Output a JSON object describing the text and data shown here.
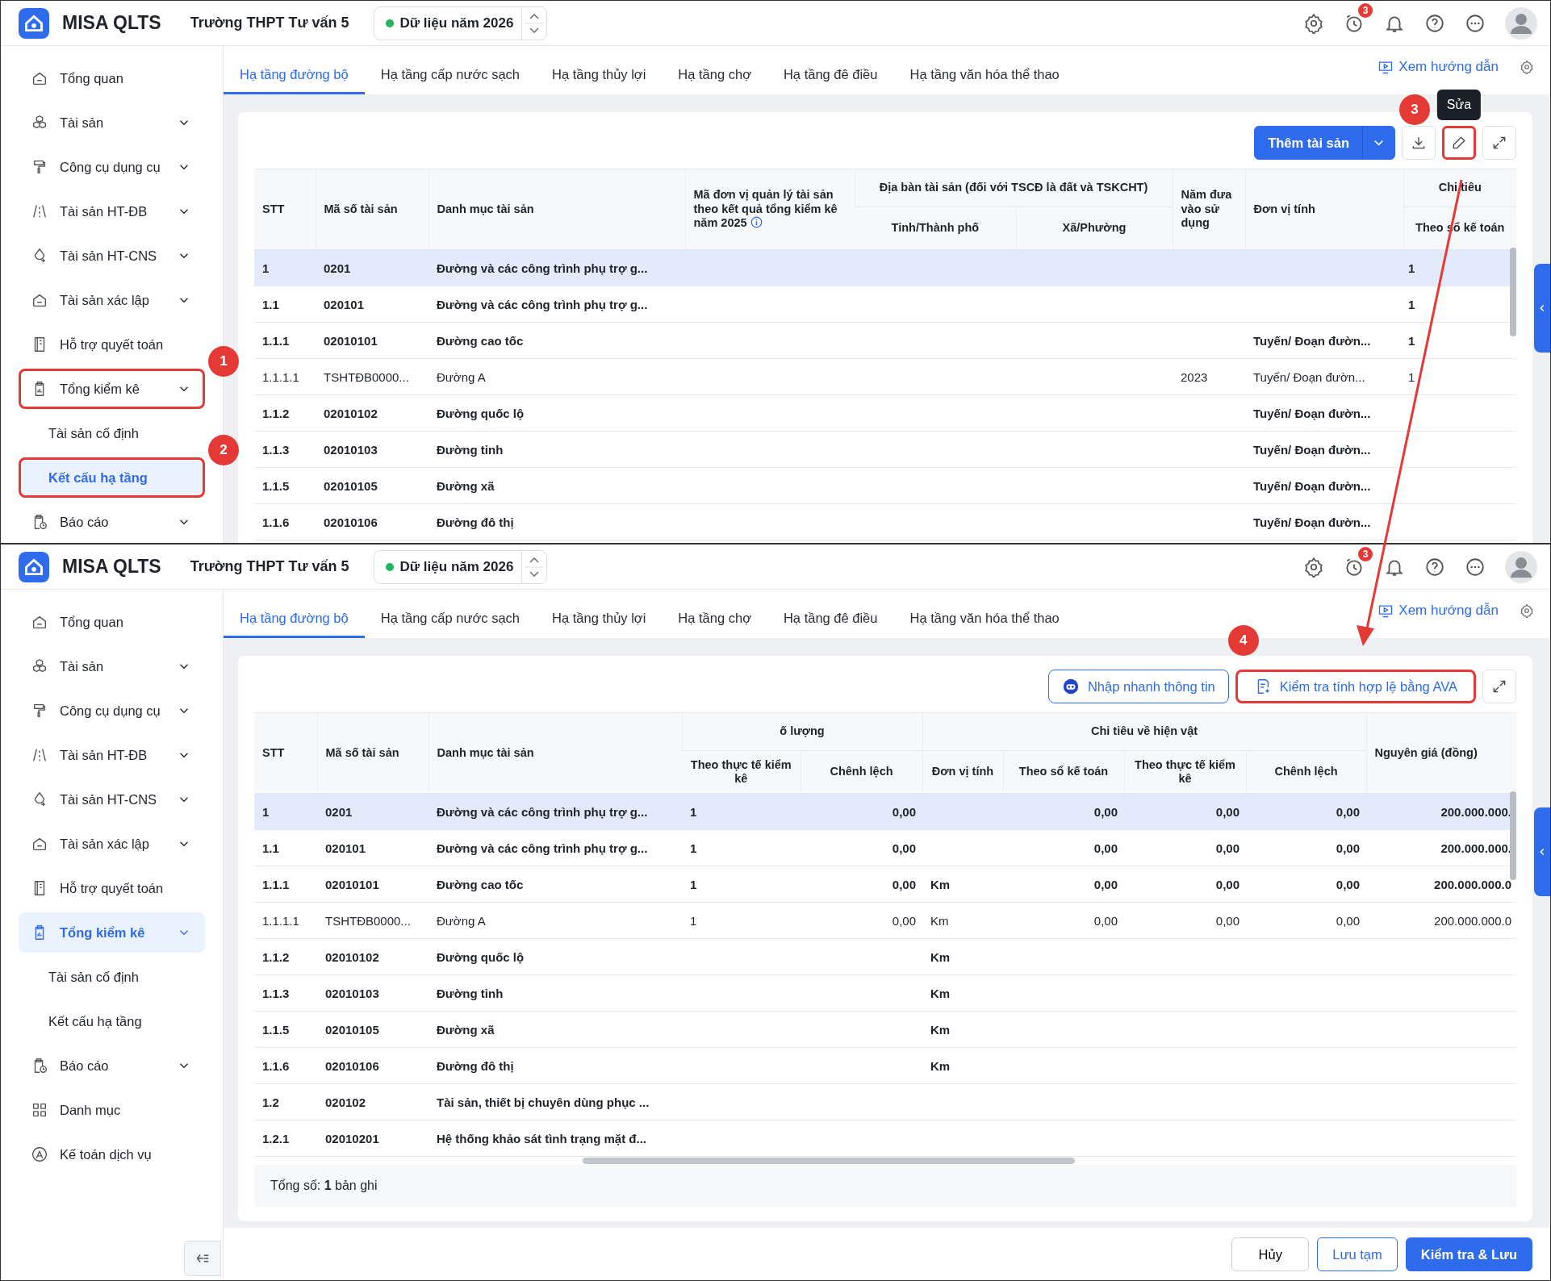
{
  "screens": [
    {
      "header": {
        "app_name": "MISA QLTS",
        "unit": "Trường THPT Tư vấn 5",
        "data_year": "Dữ liệu năm 2026",
        "badge": "3"
      },
      "sidebar": [
        {
          "label": "Tổng quan",
          "kind": "link",
          "selected": false
        },
        {
          "label": "Tài sản",
          "kind": "menu",
          "selected": false
        },
        {
          "label": "Công cụ dụng cụ",
          "kind": "menu",
          "selected": false
        },
        {
          "label": "Tài sản HT-ĐB",
          "kind": "menu",
          "selected": false
        },
        {
          "label": "Tài sản HT-CNS",
          "kind": "menu",
          "selected": false
        },
        {
          "label": "Tài sản xác lập",
          "kind": "menu",
          "selected": false
        },
        {
          "label": "Hỗ trợ quyết toán",
          "kind": "link",
          "selected": false
        },
        {
          "label": "Tổng kiểm kê",
          "kind": "menu",
          "selected": false,
          "marker": "1",
          "children": [
            {
              "label": "Tài sản cố định",
              "selected": false
            },
            {
              "label": "Kết cấu hạ tầng",
              "selected": true,
              "marker": "2"
            }
          ]
        },
        {
          "label": "Báo cáo",
          "kind": "menu",
          "selected": false
        }
      ],
      "guide_link": "Xem hướng dẫn",
      "tabs": [
        {
          "label": "Hạ tầng đường bộ",
          "selected": true
        },
        {
          "label": "Hạ tầng cấp nước sạch",
          "selected": false
        },
        {
          "label": "Hạ tầng thủy lợi",
          "selected": false
        },
        {
          "label": "Hạ tầng chợ",
          "selected": false
        },
        {
          "label": "Hạ tầng đê điều",
          "selected": false
        },
        {
          "label": "Hạ tầng văn hóa thể thao",
          "selected": false
        }
      ],
      "toolbar": [
        {
          "kind": "split",
          "label": "Thêm tài sản"
        },
        {
          "kind": "download"
        },
        {
          "kind": "edit",
          "marker": "3",
          "tooltip": "Sửa"
        },
        {
          "kind": "expand"
        }
      ],
      "table": {
        "columns": [
          {
            "label": "STT"
          },
          {
            "label": "Mã số tài sản"
          },
          {
            "label": "Danh mục tài sản"
          },
          {
            "label": "Mã đơn vị quản lý tài sản theo kết quả tổng kiểm kê năm 2025",
            "info": true
          },
          {
            "label": "Địa bàn tài sản (đối với TSCĐ là đất và TSKCHT)",
            "colspan": 2,
            "children": [
              {
                "label": "Tỉnh/Thành phố"
              },
              {
                "label": "Xã/Phường"
              }
            ]
          },
          {
            "label": "Năm đưa vào sử dụng"
          },
          {
            "label": "Đơn vị tính"
          },
          {
            "label": "Chi tiêu",
            "children": [
              {
                "label": "Theo sổ kế toán"
              }
            ]
          }
        ],
        "rows": [
          {
            "kind": "group",
            "selected": true,
            "cells": [
              "1",
              "0201",
              "Đường và các công trình phụ trợ g...",
              null,
              null,
              null,
              null,
              null,
              "1"
            ]
          },
          {
            "kind": "group",
            "selected": false,
            "cells": [
              "1.1",
              "020101",
              "Đường và các công trình phụ trợ g...",
              null,
              null,
              null,
              null,
              null,
              "1"
            ]
          },
          {
            "kind": "group",
            "selected": false,
            "cells": [
              "1.1.1",
              "02010101",
              "Đường cao tốc",
              null,
              null,
              null,
              null,
              "Tuyến/ Đoạn đườn...",
              "1"
            ]
          },
          {
            "kind": "asset",
            "selected": false,
            "cells": [
              "1.1.1.1",
              "TSHTĐB0000...",
              "Đường A",
              null,
              null,
              null,
              "2023",
              "Tuyến/ Đoạn đườn...",
              "1"
            ]
          },
          {
            "kind": "group",
            "selected": false,
            "cells": [
              "1.1.2",
              "02010102",
              "Đường quốc lộ",
              null,
              null,
              null,
              null,
              "Tuyến/ Đoạn đườn...",
              null
            ]
          },
          {
            "kind": "group",
            "selected": false,
            "cells": [
              "1.1.3",
              "02010103",
              "Đường tỉnh",
              null,
              null,
              null,
              null,
              "Tuyến/ Đoạn đườn...",
              null
            ]
          },
          {
            "kind": "group",
            "selected": false,
            "cells": [
              "1.1.5",
              "02010105",
              "Đường xã",
              null,
              null,
              null,
              null,
              "Tuyến/ Đoạn đườn...",
              null
            ]
          },
          {
            "kind": "group",
            "selected": false,
            "cells": [
              "1.1.6",
              "02010106",
              "Đường đô thị",
              null,
              null,
              null,
              null,
              "Tuyến/ Đoạn đườn...",
              null
            ]
          }
        ]
      }
    },
    {
      "header": {
        "app_name": "MISA QLTS",
        "unit": "Trường THPT Tư vấn 5",
        "data_year": "Dữ liệu năm 2026",
        "badge": "3"
      },
      "sidebar": [
        {
          "label": "Tổng quan",
          "kind": "link",
          "selected": false
        },
        {
          "label": "Tài sản",
          "kind": "menu",
          "selected": false
        },
        {
          "label": "Công cụ dụng cụ",
          "kind": "menu",
          "selected": false
        },
        {
          "label": "Tài sản HT-ĐB",
          "kind": "menu",
          "selected": false
        },
        {
          "label": "Tài sản HT-CNS",
          "kind": "menu",
          "selected": false
        },
        {
          "label": "Tài sản xác lập",
          "kind": "menu",
          "selected": false
        },
        {
          "label": "Hỗ trợ quyết toán",
          "kind": "link",
          "selected": false
        },
        {
          "label": "Tổng kiểm kê",
          "kind": "menu",
          "selected": true,
          "children": [
            {
              "label": "Tài sản cố định",
              "selected": false
            },
            {
              "label": "Kết cấu hạ tầng",
              "selected": false
            }
          ]
        },
        {
          "label": "Báo cáo",
          "kind": "menu",
          "selected": false
        },
        {
          "label": "Danh mục",
          "kind": "link",
          "selected": false
        },
        {
          "label": "Kế toán dịch vụ",
          "kind": "link",
          "selected": false
        }
      ],
      "guide_link": "Xem hướng dẫn",
      "tabs": [
        {
          "label": "Hạ tầng đường bộ",
          "selected": true
        },
        {
          "label": "Hạ tầng cấp nước sạch",
          "selected": false
        },
        {
          "label": "Hạ tầng thủy lợi",
          "selected": false
        },
        {
          "label": "Hạ tầng chợ",
          "selected": false
        },
        {
          "label": "Hạ tầng đê điều",
          "selected": false
        },
        {
          "label": "Hạ tầng văn hóa thể thao",
          "selected": false
        }
      ],
      "toolbar": [
        {
          "kind": "outline",
          "label": "Nhập nhanh thông tin"
        },
        {
          "kind": "outline",
          "label": "Kiểm tra tính hợp lệ bằng AVA",
          "marker": "4"
        },
        {
          "kind": "expand"
        }
      ],
      "table": {
        "columns": [
          {
            "label": "STT"
          },
          {
            "label": "Mã số tài sản"
          },
          {
            "label": "Danh mục tài sản"
          },
          {
            "label": "ố lượng",
            "colspan": 2,
            "children": [
              {
                "label": "Theo thực tế kiểm kê"
              },
              {
                "label": "Chênh lệch"
              }
            ]
          },
          {
            "label": "Chi tiêu về hiện vật",
            "colspan": 4,
            "children": [
              {
                "label": "Đơn vị tính"
              },
              {
                "label": "Theo sổ kế toán"
              },
              {
                "label": "Theo thực tế kiểm kê"
              },
              {
                "label": "Chênh lệch"
              }
            ]
          },
          {
            "label": "Nguyên giá (đồng)"
          }
        ],
        "rows": [
          {
            "kind": "group",
            "selected": true,
            "cells": [
              "1",
              "0201",
              "Đường và các công trình phụ trợ g...",
              "1",
              "0,00",
              null,
              "0,00",
              "0,00",
              "0,00",
              "200.000.000."
            ]
          },
          {
            "kind": "group",
            "selected": false,
            "cells": [
              "1.1",
              "020101",
              "Đường và các công trình phụ trợ g...",
              "1",
              "0,00",
              null,
              "0,00",
              "0,00",
              "0,00",
              "200.000.000."
            ]
          },
          {
            "kind": "group",
            "selected": false,
            "cells": [
              "1.1.1",
              "02010101",
              "Đường cao tốc",
              "1",
              "0,00",
              "Km",
              "0,00",
              "0,00",
              "0,00",
              "200.000.000.0"
            ]
          },
          {
            "kind": "asset",
            "selected": false,
            "cells": [
              "1.1.1.1",
              "TSHTĐB0000...",
              "Đường A",
              "1",
              "0,00",
              "Km",
              "0,00",
              "0,00",
              "0,00",
              "200.000.000.0"
            ]
          },
          {
            "kind": "group",
            "selected": false,
            "cells": [
              "1.1.2",
              "02010102",
              "Đường quốc lộ",
              null,
              null,
              "Km",
              null,
              null,
              null,
              null
            ]
          },
          {
            "kind": "group",
            "selected": false,
            "cells": [
              "1.1.3",
              "02010103",
              "Đường tỉnh",
              null,
              null,
              "Km",
              null,
              null,
              null,
              null
            ]
          },
          {
            "kind": "group",
            "selected": false,
            "cells": [
              "1.1.5",
              "02010105",
              "Đường xã",
              null,
              null,
              "Km",
              null,
              null,
              null,
              null
            ]
          },
          {
            "kind": "group",
            "selected": false,
            "cells": [
              "1.1.6",
              "02010106",
              "Đường đô thị",
              null,
              null,
              "Km",
              null,
              null,
              null,
              null
            ]
          },
          {
            "kind": "group",
            "selected": false,
            "cells": [
              "1.2",
              "020102",
              "Tài sản, thiết bị chuyên dùng phục ...",
              null,
              null,
              null,
              null,
              null,
              null,
              null
            ]
          },
          {
            "kind": "group",
            "selected": false,
            "cells": [
              "1.2.1",
              "02010201",
              "Hệ thống khảo sát tình trạng mặt đ...",
              null,
              null,
              null,
              null,
              null,
              null,
              null
            ]
          }
        ]
      },
      "footer_total": "Tổng số: **1** bản ghi",
      "actions": [
        {
          "kind": "secondary",
          "label": "Hủy"
        },
        {
          "kind": "outline",
          "label": "Lưu tạm"
        },
        {
          "kind": "primary",
          "label": "Kiểm tra & Lưu"
        }
      ]
    }
  ]
}
